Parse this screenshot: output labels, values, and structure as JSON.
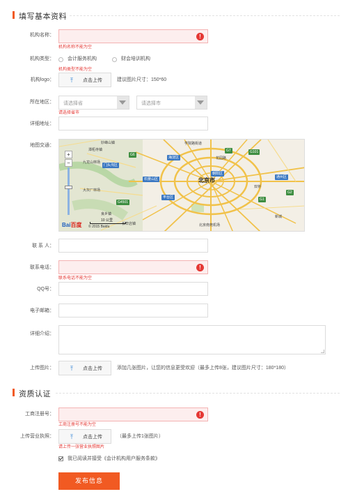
{
  "section1": {
    "title": "填写基本资料"
  },
  "section2": {
    "title": "资质认证"
  },
  "fields": {
    "org_name": {
      "label": "机构名称：",
      "error": "机构名称不能为空"
    },
    "org_type": {
      "label": "机构类型：",
      "options": [
        "会计服务机构",
        "财会培训机构"
      ],
      "error": "机构类型不能为空"
    },
    "org_logo": {
      "label": "机构logo：",
      "upload": "点击上传",
      "hint": "建议图片尺寸：150*60"
    },
    "region": {
      "label": "所在地区：",
      "province_placeholder": "请选择省",
      "city_placeholder": "请选择市",
      "error": "请选择省市"
    },
    "address": {
      "label": "详细地址："
    },
    "map": {
      "label": "地图交通："
    },
    "contact": {
      "label": "联 系 人："
    },
    "phone": {
      "label": "联系电话：",
      "error": "联系电话不能为空"
    },
    "qq": {
      "label": "QQ号："
    },
    "email": {
      "label": "电子邮箱："
    },
    "intro": {
      "label": "详细介绍："
    },
    "images": {
      "label": "上传图片：",
      "upload": "点击上传",
      "hint": "添加几张图片，让您的信息更受欢迎（最多上传8张，建议图片尺寸：180*180）"
    },
    "reg_no": {
      "label": "工商注册号：",
      "error": "工商注册号不能为空"
    },
    "license": {
      "label": "上传营业执照：",
      "upload": "点击上传",
      "hint": "（最多上传1张图片）",
      "error": "请上传一张营业执照图片"
    }
  },
  "map_view": {
    "logo": "Bai",
    "logo_accent": "百度",
    "copyright": "© 2015 Baidu",
    "scale": "10 公里",
    "city": "北京市",
    "districts": [
      "海淀区",
      "朝阳区",
      "石景山区",
      "丰台区",
      "通州区",
      "门头沟区"
    ],
    "places": [
      "学院路街道",
      "九龙山林场",
      "潭柘寺镇",
      "大灰厂林场",
      "北京南苑机场",
      "双桥",
      "妙峰山镇",
      "长辛店镇",
      "花园路",
      "新城",
      "良乡镇"
    ],
    "roads": [
      "G7",
      "G6",
      "G4501",
      "G1",
      "G2",
      "G101"
    ],
    "zoom_in": "+",
    "zoom_out": "−"
  },
  "agreement": {
    "text": "我已阅读并接受《会计机构用户服务条款》"
  },
  "submit": {
    "label": "发布信息"
  },
  "icons": {
    "error": "!",
    "upload": "⤒"
  },
  "colors": {
    "accent": "#f15a22",
    "error": "#e53935",
    "error_bg": "#fdeeee",
    "link_blue": "#2a7fd4"
  }
}
